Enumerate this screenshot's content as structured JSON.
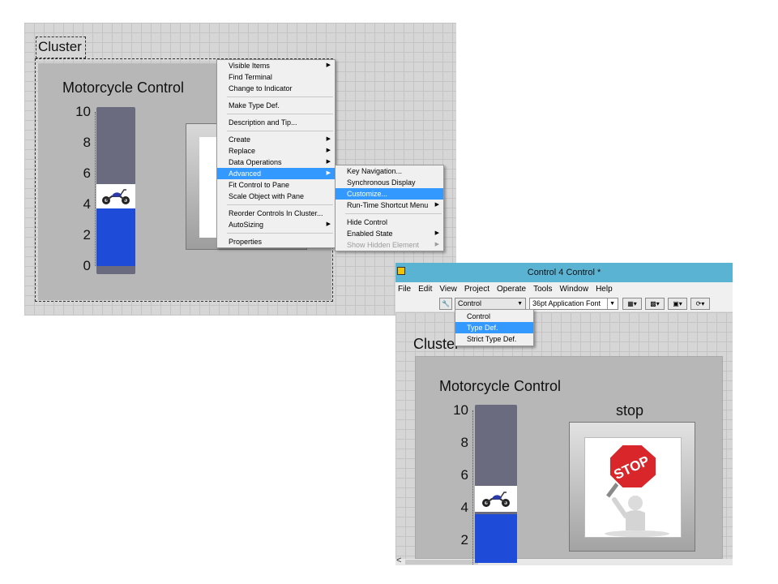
{
  "left_panel": {
    "cluster_label": "Cluster",
    "slider_title": "Motorcycle Control",
    "scale_ticks": [
      "10",
      "8",
      "6",
      "4",
      "2",
      "0"
    ],
    "slider_value": 4
  },
  "context_menu": {
    "items": [
      {
        "label": "Visible Items",
        "submenu": true
      },
      {
        "label": "Find Terminal"
      },
      {
        "label": "Change to Indicator"
      },
      {
        "sep": true
      },
      {
        "label": "Make Type Def."
      },
      {
        "sep": true
      },
      {
        "label": "Description and Tip..."
      },
      {
        "sep": true
      },
      {
        "label": "Create",
        "submenu": true
      },
      {
        "label": "Replace",
        "submenu": true
      },
      {
        "label": "Data Operations",
        "submenu": true
      },
      {
        "label": "Advanced",
        "submenu": true,
        "highlighted": true
      },
      {
        "label": "Fit Control to Pane"
      },
      {
        "label": "Scale Object with Pane"
      },
      {
        "sep": true
      },
      {
        "label": "Reorder Controls In Cluster..."
      },
      {
        "label": "AutoSizing",
        "submenu": true
      },
      {
        "sep": true
      },
      {
        "label": "Properties"
      }
    ]
  },
  "advanced_submenu": {
    "items": [
      {
        "label": "Key Navigation..."
      },
      {
        "label": "Synchronous Display"
      },
      {
        "label": "Customize...",
        "highlighted": true
      },
      {
        "label": "Run-Time Shortcut Menu",
        "submenu": true
      },
      {
        "sep": true
      },
      {
        "label": "Hide Control"
      },
      {
        "label": "Enabled State",
        "submenu": true
      },
      {
        "label": "Show Hidden Element",
        "submenu": true,
        "disabled": true
      }
    ]
  },
  "window": {
    "title": "Control 4 Control *",
    "menu": [
      "File",
      "Edit",
      "View",
      "Project",
      "Operate",
      "Tools",
      "Window",
      "Help"
    ],
    "control_type_select": "Control",
    "control_type_options": [
      "Control",
      "Type Def.",
      "Strict Type Def."
    ],
    "control_type_highlighted": "Type Def.",
    "font_select": "36pt Application Font",
    "cluster_label": "Cluster",
    "slider_title": "Motorcycle Control",
    "scale_ticks": [
      "10",
      "8",
      "6",
      "4",
      "2"
    ],
    "stop_label": "stop",
    "stop_sign_text": "STOP",
    "scroll_left_arrow": "<"
  },
  "colors": {
    "titlebar": "#5bb3d4",
    "menu_highlight": "#3399ff",
    "slider_fill": "#1e4bd8",
    "slider_track": "#6b6b80",
    "cluster_bg": "#b7b7b7"
  }
}
